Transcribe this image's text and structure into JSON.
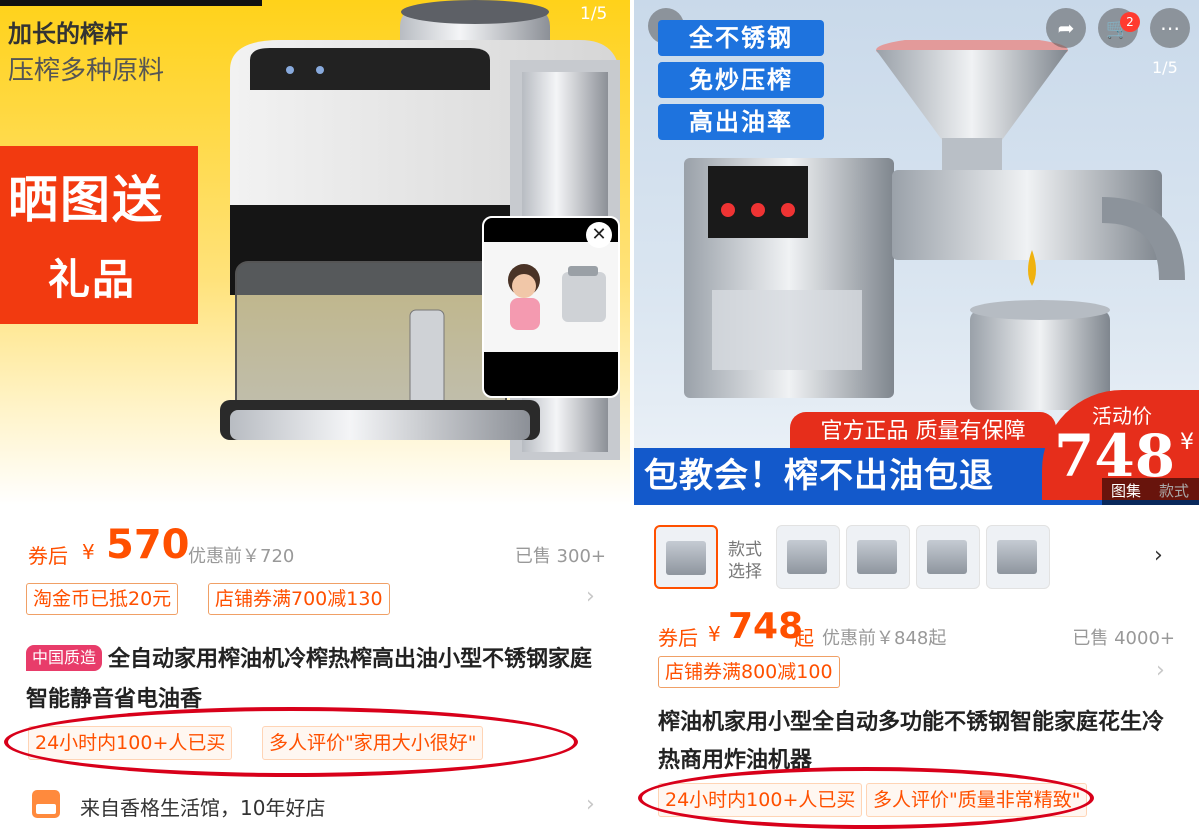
{
  "left": {
    "hero": {
      "title1": "加长的榨杆",
      "title2": "压榨多种原料",
      "promo_line1": "晒图送",
      "promo_line2": "礼品",
      "counter": "1/5"
    },
    "mini_video": {
      "close_label": "✕"
    },
    "price": {
      "coupon_prefix": "券后",
      "currency": "¥",
      "amount": "570",
      "original": "优惠前￥720",
      "sold": "已售 300+"
    },
    "tags": [
      "淘金币已抵20元",
      "店铺券满700减130"
    ],
    "title": {
      "badge": "中国质造",
      "text": "全自动家用榨油机冷榨热榨高出油小型不锈钢家庭智能静音省电油香"
    },
    "review_tags": [
      "24小时内100+人已买",
      "多人评价\"家用大小很好\""
    ],
    "shop": {
      "text": "来自香格生活馆，10年好店"
    }
  },
  "right": {
    "hero": {
      "labels": [
        "全不锈钢",
        "免炒压榨",
        "高出油率"
      ],
      "cart_count": "2",
      "counter": "1/5",
      "guarantee": "官方正品 质量有保障",
      "banner": "包教会！榨不出油包退",
      "promo_label": "活动价",
      "promo_price": "748",
      "promo_yen": "¥",
      "gallery_tabs": [
        "图集",
        "款式"
      ]
    },
    "style_label_line1": "款式",
    "style_label_line2": "选择",
    "price": {
      "coupon_prefix": "券后",
      "currency": "¥",
      "amount": "748",
      "suffix": "起",
      "original": "优惠前￥848起",
      "sold": "已售 4000+"
    },
    "tags": [
      "店铺券满800减100"
    ],
    "title": "榨油机家用小型全自动多功能不锈钢智能家庭花生冷热商用炸油机器",
    "review_tags": [
      "24小时内100+人已买",
      "多人评价\"质量非常精致\""
    ]
  },
  "colors": {
    "accent": "#ff5000",
    "promo_red": "#f23a10",
    "banner_blue": "#1359cb",
    "label_blue": "#1e73de",
    "annotation_red": "#d8001a"
  },
  "icons": [
    "back-arrow-icon",
    "share-icon",
    "cart-icon",
    "more-icon",
    "close-icon",
    "chevron-right-icon",
    "shop-icon"
  ]
}
